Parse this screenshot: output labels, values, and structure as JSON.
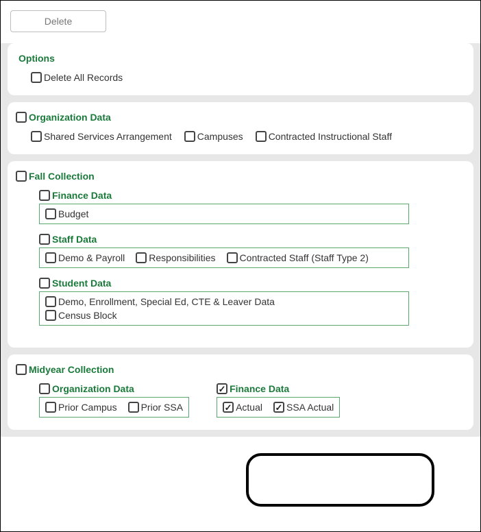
{
  "toolbar": {
    "delete_label": "Delete"
  },
  "options": {
    "title": "Options",
    "delete_all": "Delete All Records"
  },
  "org_data": {
    "title": "Organization Data",
    "shared_services": "Shared Services Arrangement",
    "campuses": "Campuses",
    "contracted_staff": "Contracted Instructional Staff"
  },
  "fall": {
    "title": "Fall Collection",
    "finance": {
      "title": "Finance Data",
      "budget": "Budget"
    },
    "staff": {
      "title": "Staff Data",
      "demo_payroll": "Demo & Payroll",
      "responsibilities": "Responsibilities",
      "contracted": "Contracted Staff (Staff Type 2)"
    },
    "student": {
      "title": "Student Data",
      "demo": "Demo, Enrollment, Special Ed, CTE & Leaver Data",
      "census": "Census Block"
    }
  },
  "midyear": {
    "title": "Midyear Collection",
    "org": {
      "title": "Organization Data",
      "prior_campus": "Prior Campus",
      "prior_ssa": "Prior SSA"
    },
    "finance": {
      "title": "Finance Data",
      "actual": "Actual",
      "ssa_actual": "SSA Actual"
    }
  }
}
